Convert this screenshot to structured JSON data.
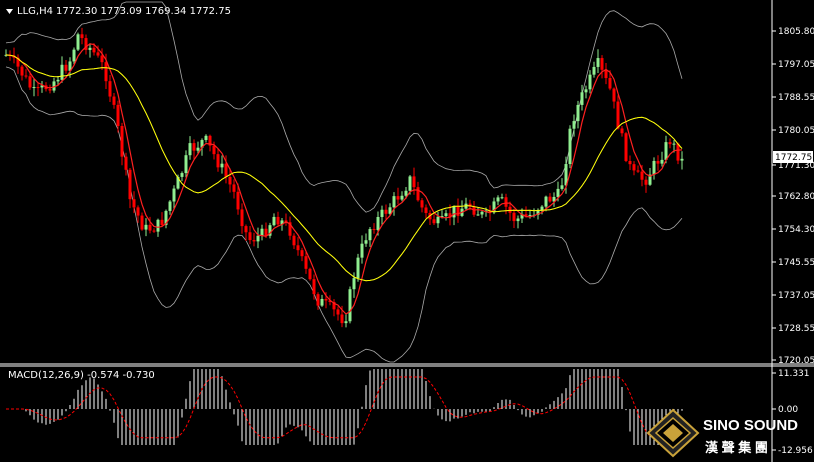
{
  "window": {
    "symbol_label": "LLG,H4",
    "ohlc": "1772.30 1773.09 1769.34 1772.75",
    "menu_arrow_icon": "triangle-down-icon"
  },
  "price_axis": {
    "labels": [
      "1805.80",
      "1797.05",
      "1788.55",
      "1780.05",
      "1772.75",
      "1771.30",
      "1762.80",
      "1754.30",
      "1745.55",
      "1737.05",
      "1728.55",
      "1720.05"
    ],
    "current_price": "1772.75"
  },
  "macd_panel": {
    "label": "MACD(12,26,9) -0.574 -0.730",
    "axis_labels": [
      "11.331",
      "0.00",
      "-12.956"
    ]
  },
  "logo": {
    "name": "SINO SOUND",
    "chinese": "漢 聲 集 團",
    "icon": "diamond-logo-icon"
  },
  "colors": {
    "background": "#000000",
    "bull_candle": "#90ee90",
    "bear_candle": "#ff0000",
    "ma_line": "#ffff00",
    "ma_line_alt": "#ff2020",
    "bollinger": "#aaaaaa",
    "macd_hist": "#ffffff",
    "macd_signal": "#ff0000",
    "grid_border": "#ffffff"
  }
}
